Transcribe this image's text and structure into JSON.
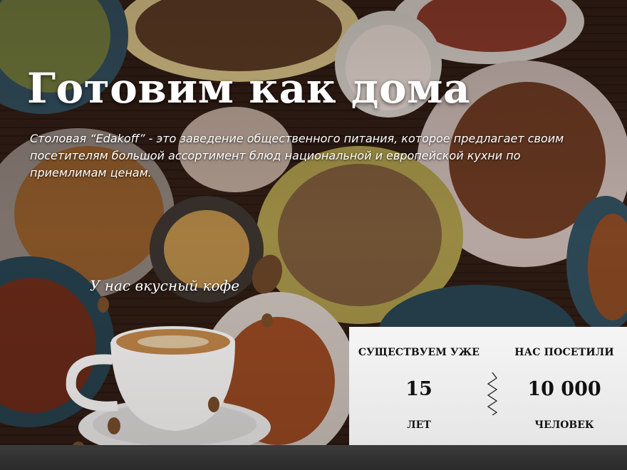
{
  "hero": {
    "title": "Готовим как дома",
    "description": "Столовая “Edakoff” - это заведение общественного питания, которое предлагает своим посетителям большой ассортимент блюд национальной и европейской кухни по приемлимам ценам.",
    "coffee_caption": "У нас вкусный кофе",
    "background_icon": "food-table-photo",
    "coffee_icon": "coffee-cup-icon"
  },
  "stats": {
    "years": {
      "label": "СУЩЕСТВУЕМ УЖЕ",
      "value": "15",
      "unit": "ЛЕТ"
    },
    "visitors": {
      "label": "НАС ПОСЕТИЛИ",
      "value": "10 000",
      "unit": "ЧЕЛОВЕК"
    },
    "divider_icon": "zigzag-divider-icon"
  },
  "colors": {
    "text_light": "#ffffff",
    "text_dark": "#111111",
    "panel": "#eeeeee",
    "strip": "#333333"
  }
}
